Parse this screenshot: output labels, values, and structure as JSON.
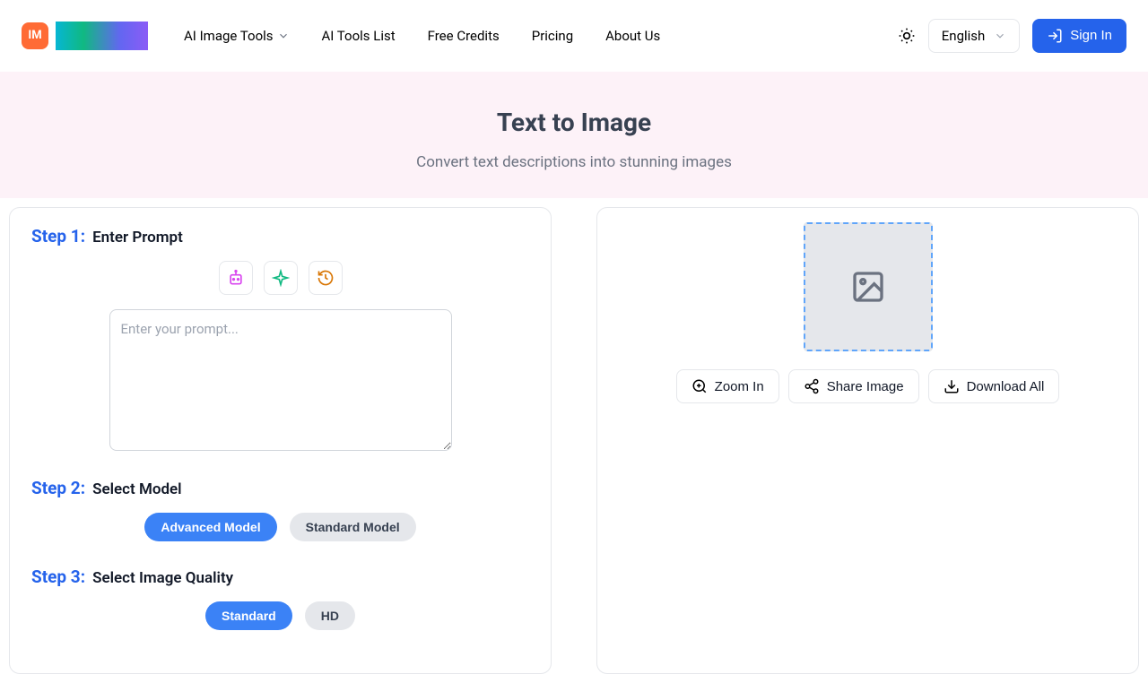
{
  "logo": {
    "badge_text": "IM"
  },
  "nav": {
    "items": [
      {
        "label": "AI Image Tools",
        "has_dropdown": true
      },
      {
        "label": "AI Tools List",
        "has_dropdown": false
      },
      {
        "label": "Free Credits",
        "has_dropdown": false
      },
      {
        "label": "Pricing",
        "has_dropdown": false
      },
      {
        "label": "About Us",
        "has_dropdown": false
      }
    ]
  },
  "header": {
    "language": "English",
    "signin": "Sign In"
  },
  "hero": {
    "title": "Text to Image",
    "subtitle": "Convert text descriptions into stunning images"
  },
  "steps": {
    "step1": {
      "label": "Step 1:",
      "title": "Enter Prompt",
      "placeholder": "Enter your prompt..."
    },
    "step2": {
      "label": "Step 2:",
      "title": "Select Model",
      "options": [
        "Advanced Model",
        "Standard Model"
      ]
    },
    "step3": {
      "label": "Step 3:",
      "title": "Select Image Quality",
      "options": [
        "Standard",
        "HD"
      ]
    }
  },
  "output": {
    "actions": {
      "zoom": "Zoom In",
      "share": "Share Image",
      "download": "Download All"
    }
  }
}
